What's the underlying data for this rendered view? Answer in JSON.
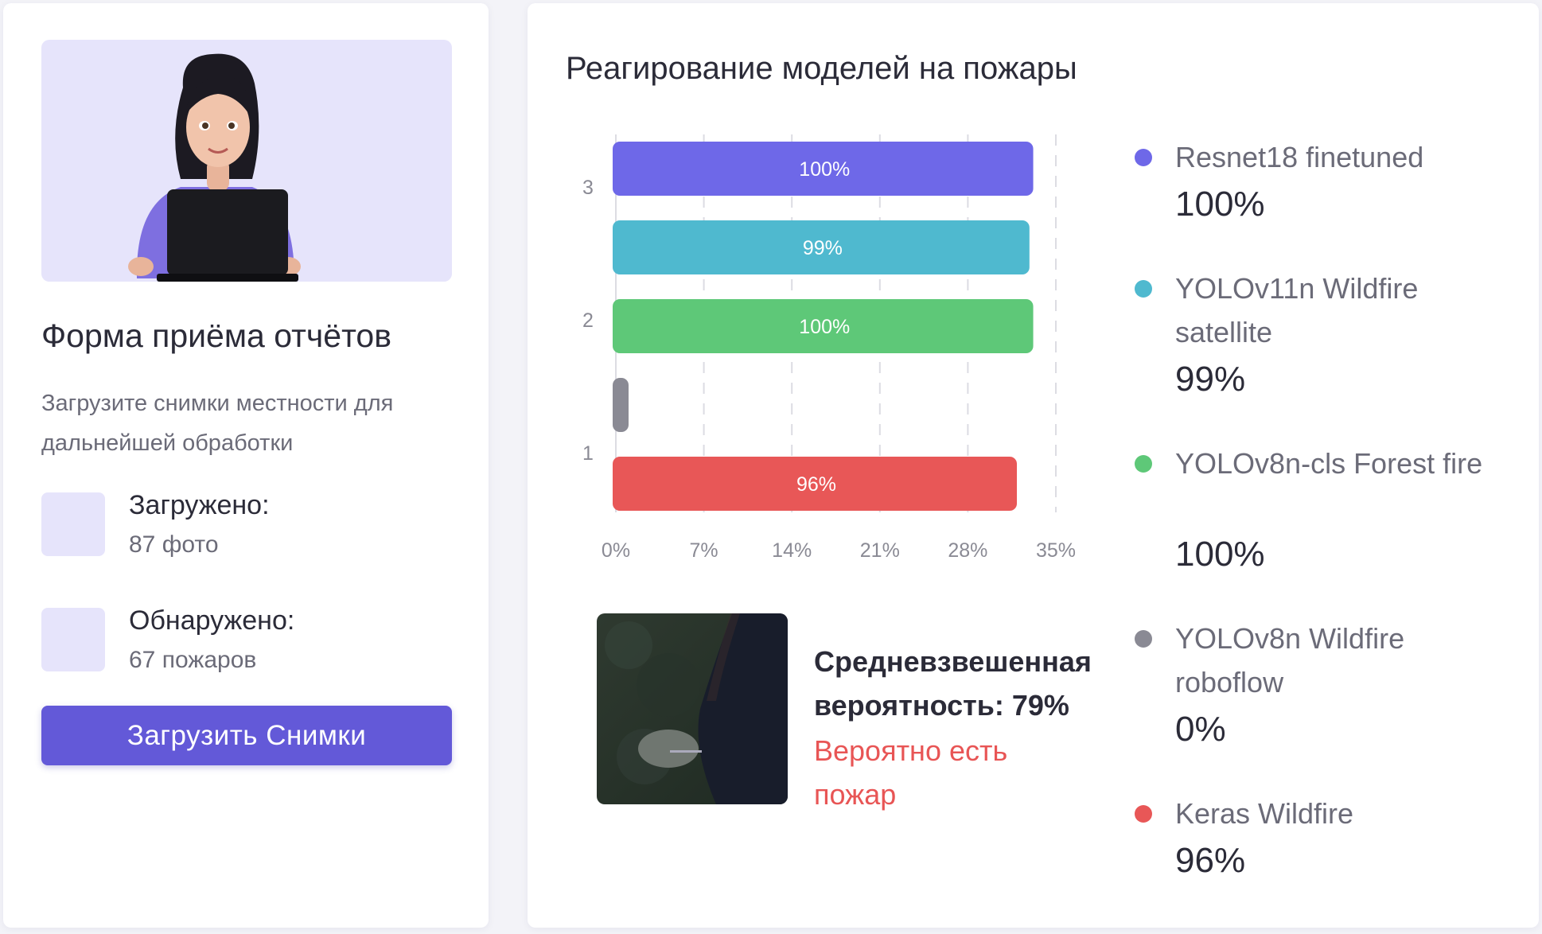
{
  "report_form": {
    "title": "Форма приёма отчётов",
    "description": "Загрузите снимки местности для дальнейшей обработки",
    "uploaded_label": "Загружено:",
    "uploaded_value": "87 фото",
    "detected_label": "Обнаружено:",
    "detected_value": "67 пожаров",
    "upload_button": "Загрузить Снимки",
    "illustration_icon": "woman-with-laptop-illustration"
  },
  "dashboard": {
    "title": "Реагирование моделей на пожары",
    "average_label": "Средневзвешенная вероятность: 79%",
    "verdict": "Вероятно есть пожар",
    "satellite_image_icon": "satellite-image-thumbnail"
  },
  "legend": [
    {
      "name": "Resnet18 finetuned",
      "value": "100%",
      "color": "#6e68e8"
    },
    {
      "name": "YOLOv11n Wildfire satellite",
      "value": "99%",
      "color": "#4fb9cf"
    },
    {
      "name": "YOLOv8n-cls Forest fire",
      "value": "100%",
      "color": "#5ec878"
    },
    {
      "name": "YOLOv8n Wildfire roboflow",
      "value": "0%",
      "color": "#8a8a94"
    },
    {
      "name": "Keras Wildfire",
      "value": "96%",
      "color": "#e85757"
    }
  ],
  "chart_data": {
    "type": "bar",
    "orientation": "horizontal",
    "title": "",
    "y_ticks": [
      "3",
      "2",
      "1"
    ],
    "x_ticks": [
      "0%",
      "7%",
      "14%",
      "21%",
      "28%",
      "35%"
    ],
    "xlim": [
      0,
      35
    ],
    "grid": "vertical dashed",
    "bars": [
      {
        "model": "Resnet18 finetuned",
        "value": 33.2,
        "label": "100%",
        "color": "#6e68e8"
      },
      {
        "model": "YOLOv11n Wildfire satellite",
        "value": 32.9,
        "label": "99%",
        "color": "#4fb9cf"
      },
      {
        "model": "YOLOv8n-cls Forest fire",
        "value": 33.2,
        "label": "100%",
        "color": "#5ec878"
      },
      {
        "model": "YOLOv8n Wildfire roboflow",
        "value": 1.0,
        "label": "",
        "color": "#8a8a94"
      },
      {
        "model": "Keras Wildfire",
        "value": 31.9,
        "label": "96%",
        "color": "#e85757"
      }
    ]
  }
}
